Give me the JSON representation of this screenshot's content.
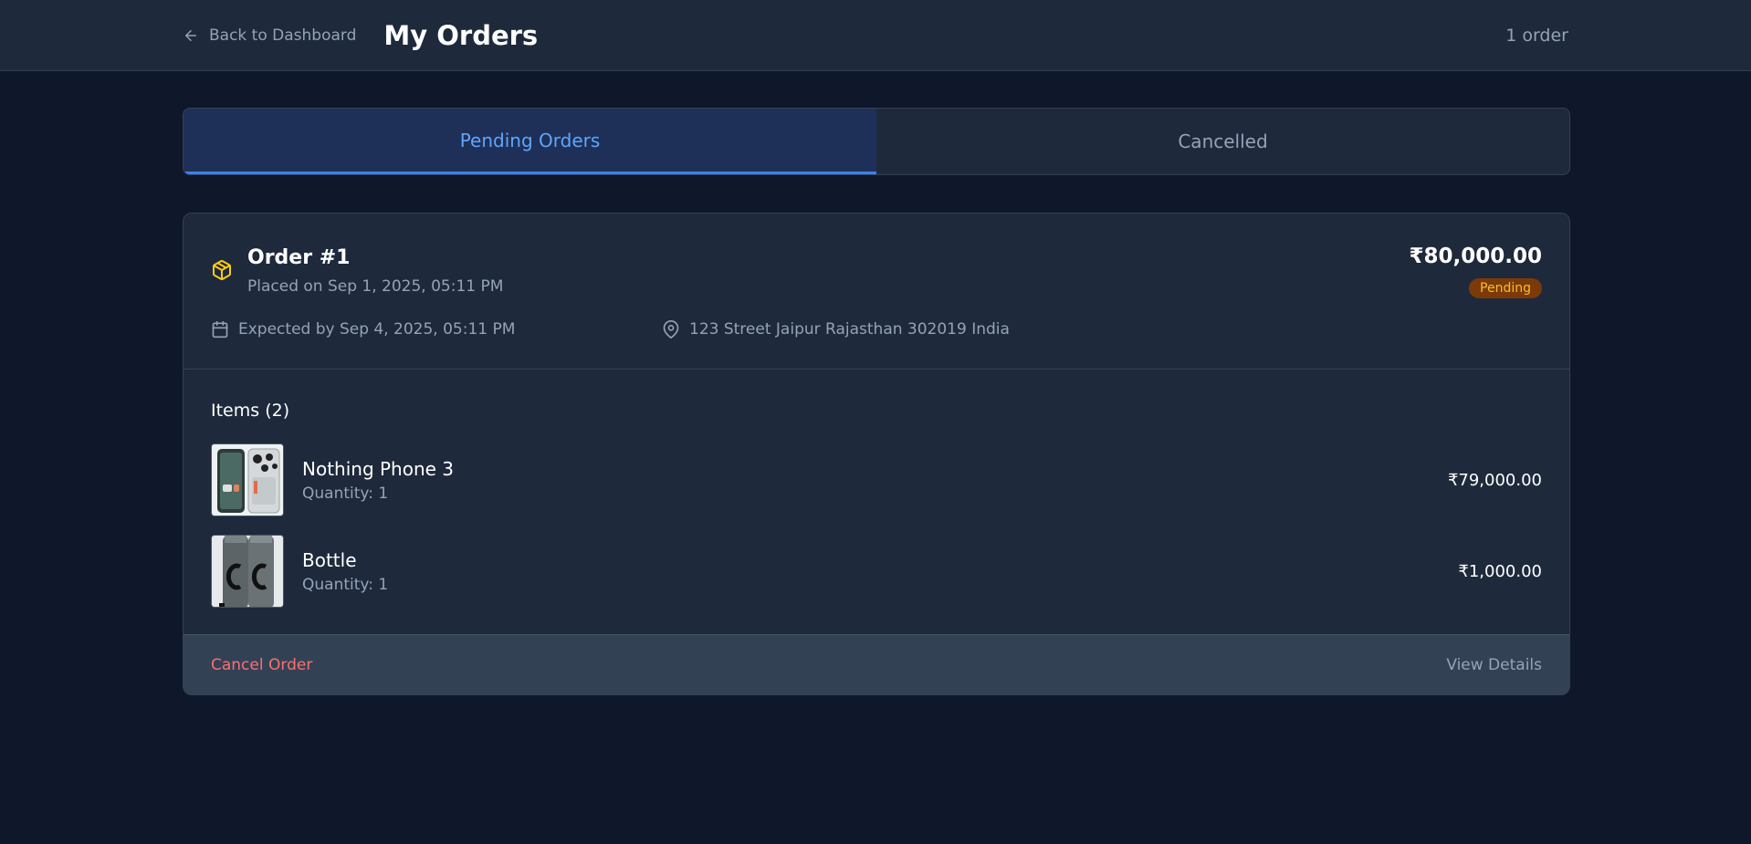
{
  "header": {
    "back_label": "Back to Dashboard",
    "title": "My Orders",
    "count": "1 order"
  },
  "tabs": [
    {
      "label": "Pending Orders",
      "active": true
    },
    {
      "label": "Cancelled",
      "active": false
    }
  ],
  "order": {
    "title": "Order #1",
    "placed_on": "Placed on Sep 1, 2025, 05:11 PM",
    "total": "₹80,000.00",
    "status": "Pending",
    "expected": "Expected by Sep 4, 2025, 05:11 PM",
    "address": "123 Street Jaipur Rajasthan 302019 India",
    "items_title": "Items (2)",
    "items": [
      {
        "name": "Nothing Phone 3",
        "quantity": "Quantity: 1",
        "price": "₹79,000.00"
      },
      {
        "name": "Bottle",
        "quantity": "Quantity: 1",
        "price": "₹1,000.00"
      }
    ],
    "cancel_label": "Cancel Order",
    "details_label": "View Details"
  },
  "colors": {
    "background": "#0f172a",
    "surface": "#1e293b",
    "accent": "#3b82f6",
    "pending_badge": "#7c3a09",
    "danger": "#f87171",
    "icon_accent": "#facc15"
  }
}
